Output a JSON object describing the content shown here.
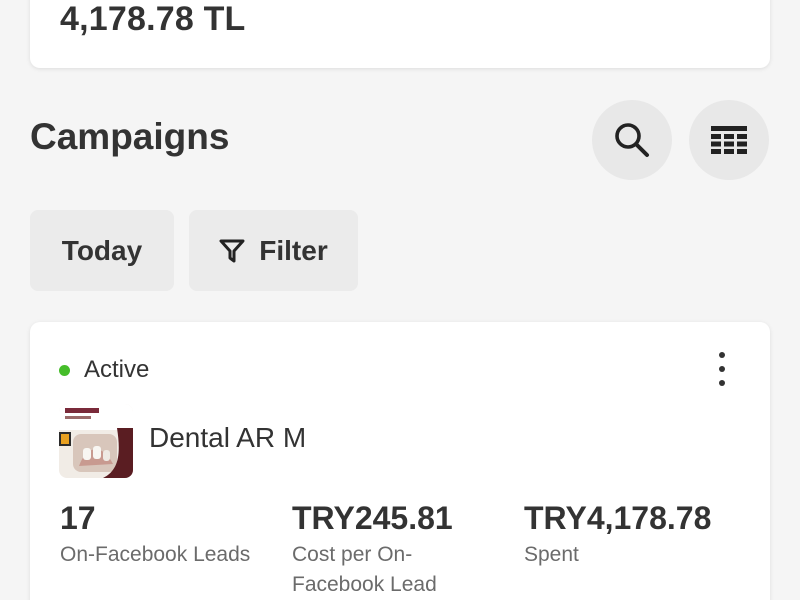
{
  "summary": {
    "amount": "4,178.78 TL"
  },
  "section": {
    "title": "Campaigns"
  },
  "toolbar": {
    "search_icon": "search-icon",
    "columns_icon": "table-columns-icon"
  },
  "filters": {
    "today_label": "Today",
    "filter_label": "Filter",
    "filter_icon": "funnel-icon"
  },
  "campaign": {
    "status": "Active",
    "status_color": "#45bd2a",
    "name": "Dental AR M",
    "metrics": [
      {
        "value": "17",
        "label": "On-Facebook Leads"
      },
      {
        "value": "TRY245.81",
        "label": "Cost per On-Facebook Lead"
      },
      {
        "value": "TRY4,178.78",
        "label": "Spent"
      }
    ]
  }
}
